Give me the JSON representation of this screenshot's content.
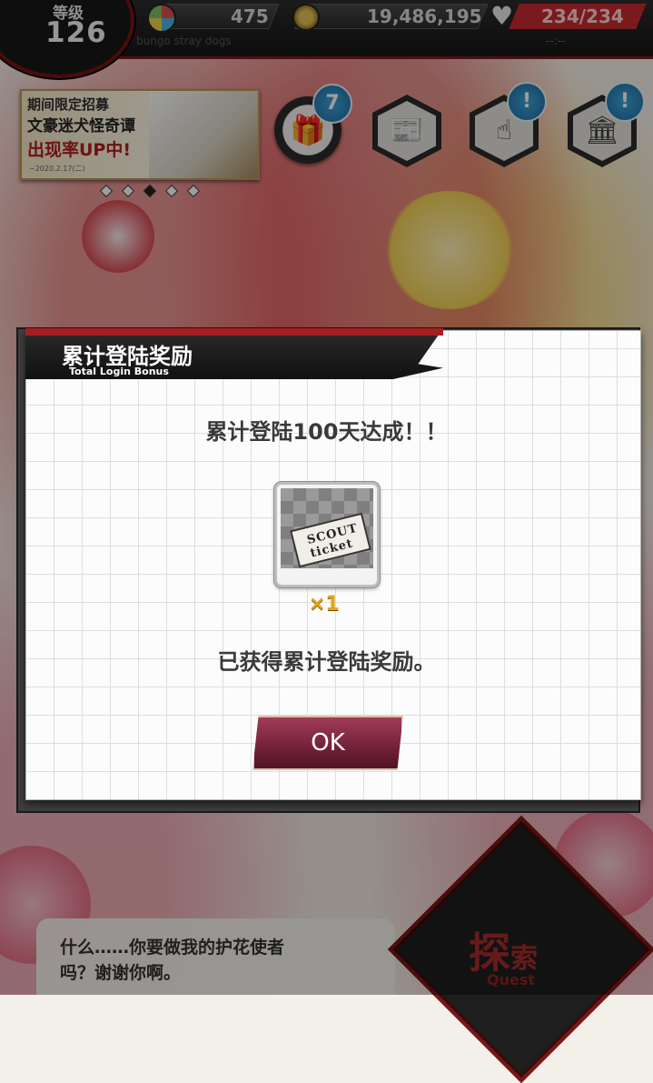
{
  "status_bar": {
    "level_label": "等级",
    "level_value": "126",
    "gems": "475",
    "coins": "19,486,195",
    "stamina": "234/234",
    "subtitle": "bungo stray dogs",
    "timer": "--:--",
    "icons": [
      "gem-icon",
      "coin-icon",
      "heart-icon"
    ]
  },
  "banner": {
    "line1": "期间限定招募",
    "line2": "文豪迷犬怪奇谭",
    "line3": "出现率UP中!",
    "line4": "~2020.2.17(二)"
  },
  "buttons": {
    "gift_badge": "7",
    "notice_badge_1": "!",
    "notice_badge_2": "!",
    "icons": [
      "gift-icon",
      "newspaper-icon",
      "touch-icon",
      "building-icon"
    ]
  },
  "modal": {
    "title": "累计登陆奖励",
    "subtitle": "Total Login Bonus",
    "achievement": "累计登陆100天达成！！",
    "item_name": "SCOUT ticket",
    "quantity": "×1",
    "obtained": "已获得累计登陆奖励。",
    "ok_label": "OK"
  },
  "dialogue": {
    "line1": "什么……你要做我的护花使者",
    "line2": "吗？谢谢你啊。"
  },
  "quest": {
    "label_main": "探",
    "label_sub": "索",
    "label_en": "Quest"
  },
  "colors": {
    "accent_red": "#a51f22",
    "ok_button": "#7a2340",
    "badge_blue": "#2f8cc6",
    "qty_gold": "#e1a51c"
  }
}
